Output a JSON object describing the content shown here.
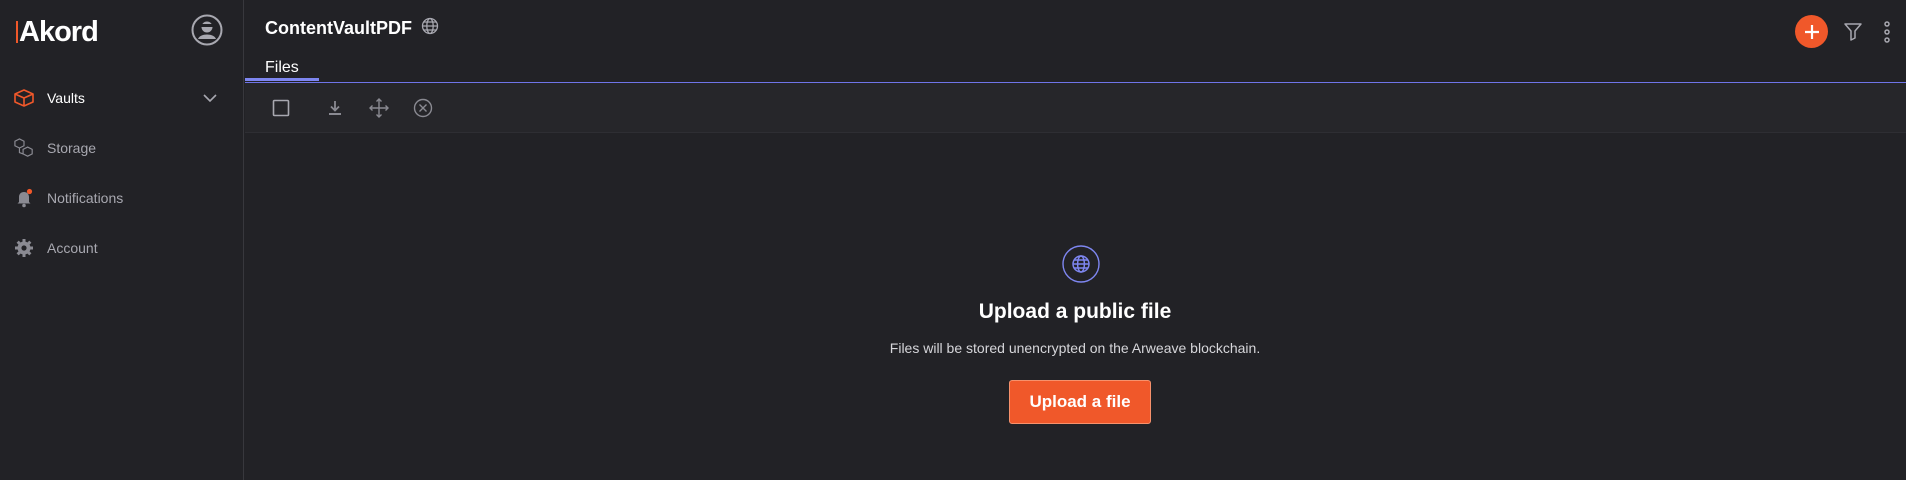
{
  "app": {
    "logo_text": "Akord"
  },
  "sidebar": {
    "items": [
      {
        "label": "Vaults",
        "icon": "vault-icon",
        "active": true
      },
      {
        "label": "Storage",
        "icon": "storage-icon"
      },
      {
        "label": "Notifications",
        "icon": "bell-icon"
      },
      {
        "label": "Account",
        "icon": "gear-icon"
      }
    ]
  },
  "header": {
    "title": "ContentVaultPDF",
    "tabs": [
      {
        "label": "Files",
        "active": true
      }
    ]
  },
  "toolbar": {
    "icons": [
      "checkbox-icon",
      "download-icon",
      "move-icon",
      "remove-icon"
    ]
  },
  "empty_state": {
    "icon": "globe-icon",
    "title": "Upload a public file",
    "subtitle": "Files will be stored unencrypted on the Arweave blockchain.",
    "button_label": "Upload a file"
  },
  "colors": {
    "background": "#222226",
    "accent": "#f0582a",
    "tab_indicator": "#7e86f0"
  }
}
